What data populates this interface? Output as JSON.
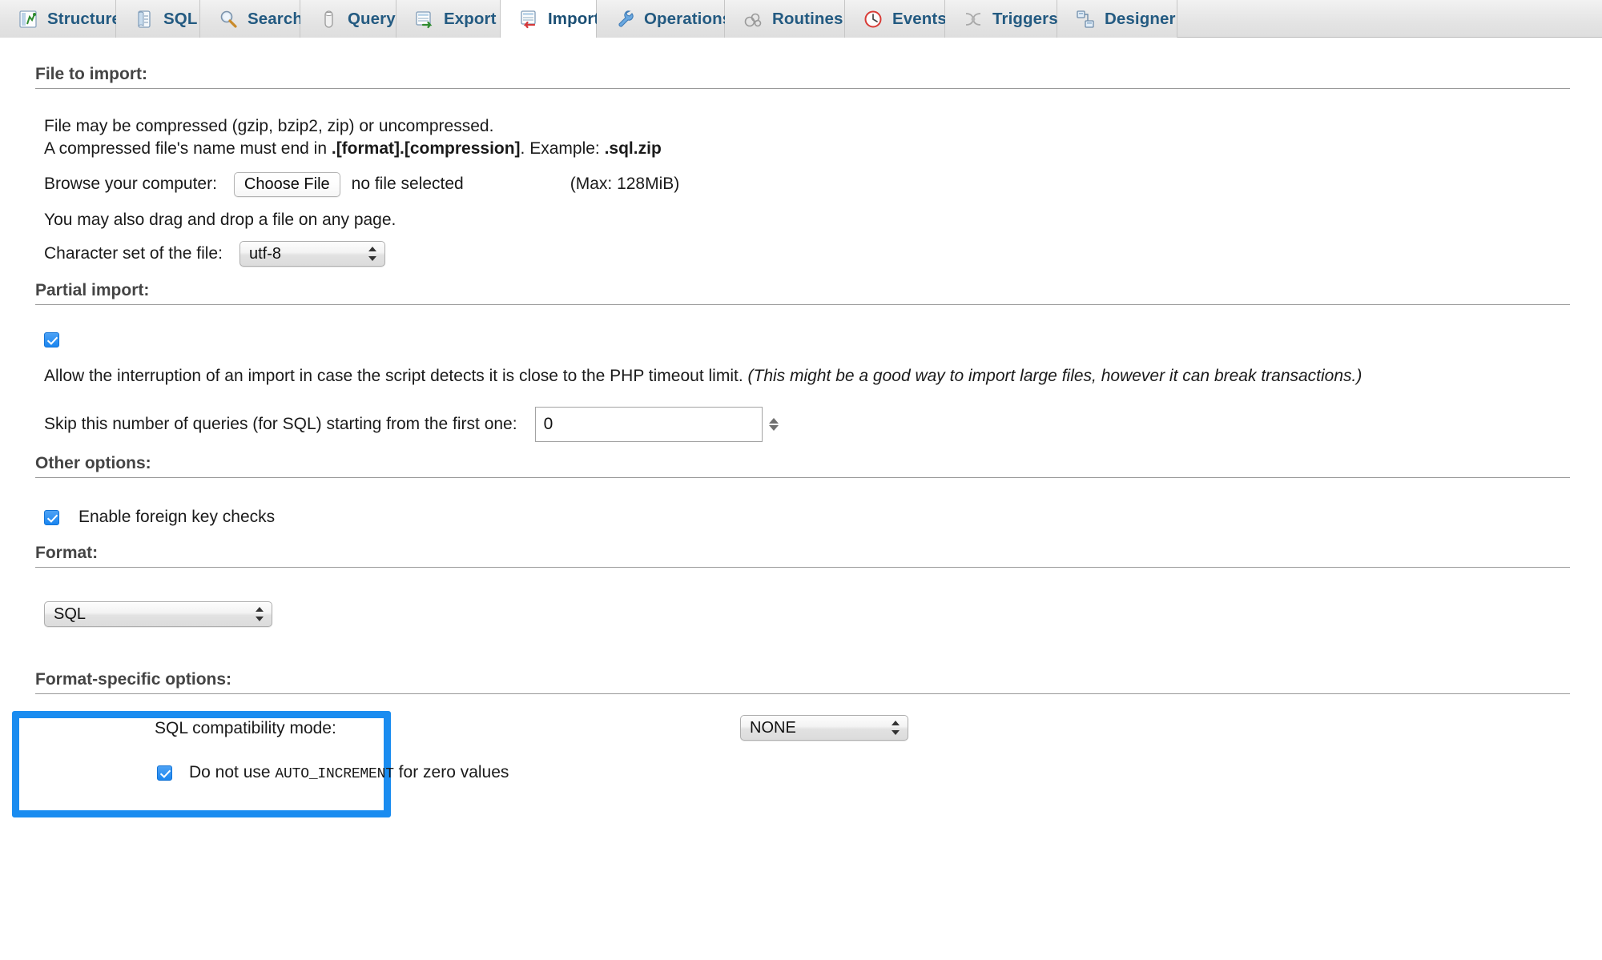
{
  "tabs": [
    {
      "label": "Structure",
      "icon": "structure-icon",
      "active": false
    },
    {
      "label": "SQL",
      "icon": "sql-icon",
      "active": false
    },
    {
      "label": "Search",
      "icon": "search-icon",
      "active": false
    },
    {
      "label": "Query",
      "icon": "query-icon",
      "active": false
    },
    {
      "label": "Export",
      "icon": "export-icon",
      "active": false
    },
    {
      "label": "Import",
      "icon": "import-icon",
      "active": true
    },
    {
      "label": "Operations",
      "icon": "operations-icon",
      "active": false
    },
    {
      "label": "Routines",
      "icon": "routines-icon",
      "active": false
    },
    {
      "label": "Events",
      "icon": "events-icon",
      "active": false
    },
    {
      "label": "Triggers",
      "icon": "triggers-icon",
      "active": false
    },
    {
      "label": "Designer",
      "icon": "designer-icon",
      "active": false
    }
  ],
  "file_to_import": {
    "legend": "File to import:",
    "line1": "File may be compressed (gzip, bzip2, zip) or uncompressed.",
    "line2_prefix": "A compressed file's name must end in ",
    "line2_bold1": ".[format].[compression]",
    "line2_mid": ". Example: ",
    "line2_bold2": ".sql.zip",
    "browse_label": "Browse your computer:",
    "choose_file_button": "Choose File",
    "file_status": "no file selected",
    "max_size": "(Max: 128MiB)",
    "dragdrop_note": "You may also drag and drop a file on any page.",
    "charset_label": "Character set of the file:",
    "charset_value": "utf-8"
  },
  "partial_import": {
    "legend": "Partial import:",
    "allow_interruption_checked": true,
    "allow_interruption_text": "Allow the interruption of an import in case the script detects it is close to the PHP timeout limit.",
    "allow_interruption_note": "(This might be a good way to import large files, however it can break transactions.)",
    "skip_label": "Skip this number of queries (for SQL) starting from the first one:",
    "skip_value": "0"
  },
  "other_options": {
    "legend": "Other options:",
    "foreign_key_checked": true,
    "foreign_key_label": "Enable foreign key checks"
  },
  "format": {
    "legend": "Format:",
    "value": "SQL",
    "highlight_color": "#1a8cf0"
  },
  "format_specific": {
    "legend": "Format-specific options:",
    "compat_label": "SQL compatibility mode:",
    "compat_value": "NONE",
    "auto_increment_checked": true,
    "auto_increment_prefix": "Do not use ",
    "auto_increment_mono": "AUTO_INCREMENT",
    "auto_increment_suffix": " for zero values"
  }
}
